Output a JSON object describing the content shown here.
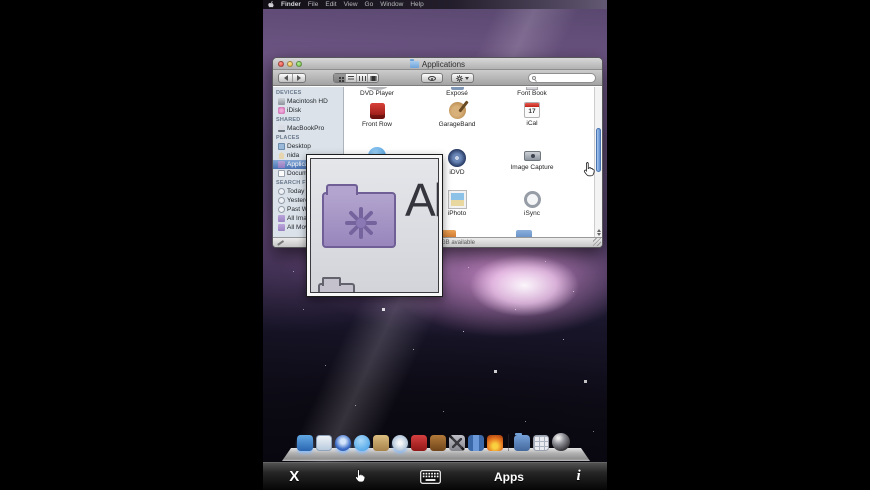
{
  "menubar": {
    "apple_icon": "apple-logo",
    "items": [
      "Finder",
      "File",
      "Edit",
      "View",
      "Go",
      "Window",
      "Help"
    ]
  },
  "finder": {
    "title": "Applications",
    "status_text": "GB available",
    "sidebar": {
      "devices_header": "DEVICES",
      "devices": [
        "Macintosh HD",
        "iDisk"
      ],
      "shared_header": "SHARED",
      "shared": [
        "MacBookPro"
      ],
      "places_header": "PLACES",
      "places": [
        "Desktop",
        "nida",
        "Applications",
        "Documents"
      ],
      "search_header": "SEARCH FOR",
      "search": [
        "Today",
        "Yesterday",
        "Past Week",
        "All Images",
        "All Movies"
      ]
    },
    "apps": {
      "row1": [
        "DVD Player",
        "Exposé",
        "Font Book"
      ],
      "row2": [
        "Front Row",
        "GarageBand",
        "iCal"
      ],
      "ical_day": "17",
      "row3": [
        "iDVD",
        "Image Capture"
      ],
      "row4": [
        "iPhoto",
        "iSync"
      ]
    }
  },
  "loupe": {
    "magnified_text": "Al"
  },
  "dock": {
    "icons": [
      "finder",
      "mail",
      "safari",
      "ichat",
      "address-book",
      "itunes",
      "front-row",
      "garageband",
      "quicktime",
      "blue-app",
      "fire-app",
      "documents-stack",
      "downloads-stack",
      "sphere"
    ]
  },
  "app_toolbar": {
    "close_label": "X",
    "apps_label": "Apps",
    "info_label": "i",
    "icons": [
      "hand-pointer",
      "keyboard"
    ]
  },
  "cursor": {
    "type": "pointing-hand"
  },
  "colors": {
    "selection_blue": "#4a74b4",
    "aurora_pink": "#e8a8dc",
    "scroll_thumb": "#5e8fd0"
  }
}
